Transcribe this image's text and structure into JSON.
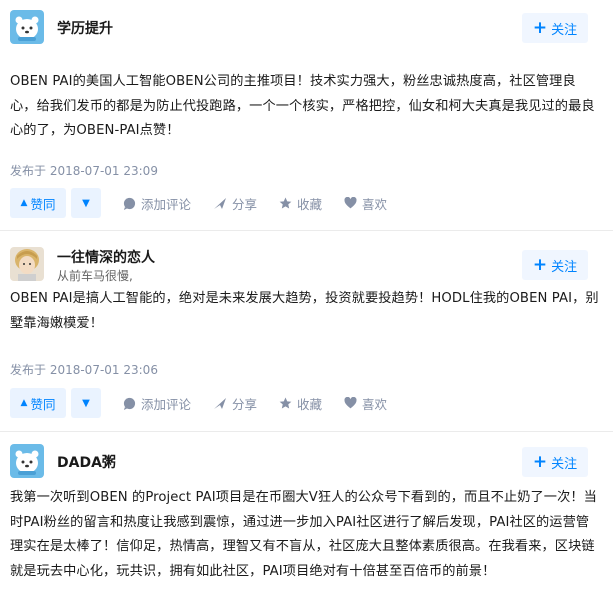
{
  "follow_label": "关注",
  "comments": [
    {
      "author": "学历提升",
      "bio": "",
      "avatar": "bear",
      "content": "OBEN PAI的美国人工智能OBEN公司的主推项目！技术实力强大，粉丝忠诚热度高，社区管理良心，给我们发币的都是为防止代投跑路，一个一个核实，严格把控，仙女和柯大夫真是我见过的最良心的了，为OBEN-PAI点赞！",
      "time": "发布于 2018-07-01 23:09",
      "actions": {
        "upvote": "赞同",
        "comment": "添加评论",
        "share": "分享",
        "favorite": "收藏",
        "like": "喜欢"
      }
    },
    {
      "author": "一往情深的恋人",
      "bio": "从前车马很慢,",
      "avatar": "person",
      "content": "OBEN PAI是搞人工智能的，绝对是未来发展大趋势，投资就要投趋势！HODL住我的OBEN PAI，别墅靠海嫩模爱！",
      "time": "发布于 2018-07-01 23:06",
      "actions": {
        "upvote": "赞同",
        "comment": "添加评论",
        "share": "分享",
        "favorite": "收藏",
        "like": "喜欢"
      }
    },
    {
      "author": "DADA粥",
      "bio": "",
      "avatar": "bear",
      "content": "我第一次听到OBEN 的Project PAI项目是在币圈大V狂人的公众号下看到的，而且不止奶了一次！当时PAI粉丝的留言和热度让我感到震惊，通过进一步加入PAI社区进行了解后发现，PAI社区的运营管理实在是太棒了！信仰足，热情高，理智又有不盲从，社区庞大且整体素质很高。在我看来，区块链就是玩去中心化，玩共识，拥有如此社区，PAI项目绝对有十倍甚至百倍币的前景！"
    }
  ],
  "colors": {
    "accent": "#0084ff",
    "meta": "#8590a6",
    "accent_bg": "#eaf3ff"
  }
}
